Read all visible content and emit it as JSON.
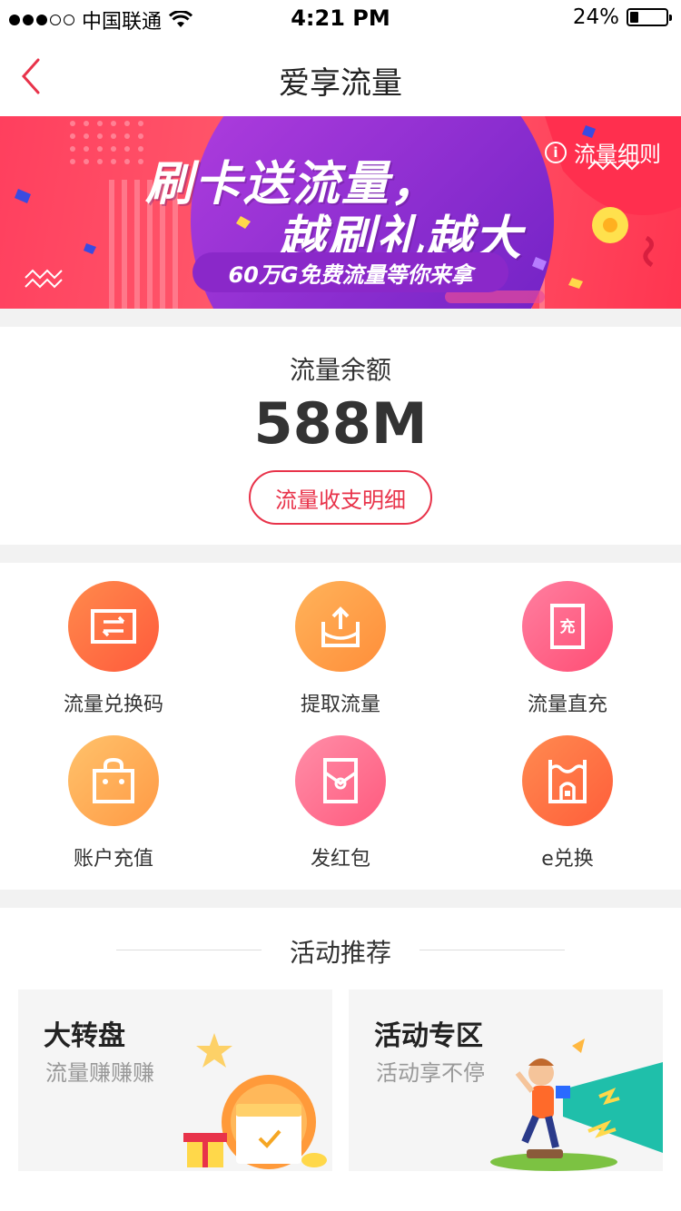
{
  "status_bar": {
    "carrier": "中国联通",
    "time": "4:21 PM",
    "battery": "24%",
    "battery_level": 0.24
  },
  "nav": {
    "title": "爱享流量"
  },
  "banner": {
    "rule_label": "流量细则",
    "headline_line1": "刷卡送流量，",
    "headline_line2": "越刷礼越大",
    "tagline": "60万G免费流量等你来拿"
  },
  "balance": {
    "label": "流量余额",
    "value": "588M",
    "detail_button": "流量收支明细"
  },
  "services": [
    {
      "label": "流量兑换码",
      "icon": "exchange-code-icon",
      "color_from": "#ff8a4c",
      "color_to": "#ff5a3c"
    },
    {
      "label": "提取流量",
      "icon": "extract-icon",
      "color_from": "#ffb35a",
      "color_to": "#ff8e3a"
    },
    {
      "label": "流量直充",
      "icon": "direct-recharge-icon",
      "color_from": "#ff7fa0",
      "color_to": "#ff4d74"
    },
    {
      "label": "账户充值",
      "icon": "shopping-bag-icon",
      "color_from": "#ffc26b",
      "color_to": "#ff9a45"
    },
    {
      "label": "发红包",
      "icon": "red-envelope-icon",
      "color_from": "#ff8ea8",
      "color_to": "#ff5a7e"
    },
    {
      "label": "e兑换",
      "icon": "e-exchange-icon",
      "color_from": "#ff8a50",
      "color_to": "#ff5e3a"
    }
  ],
  "activities": {
    "heading": "活动推荐",
    "cards": [
      {
        "title": "大转盘",
        "subtitle": "流量赚赚赚"
      },
      {
        "title": "活动专区",
        "subtitle": "活动享不停"
      }
    ]
  },
  "icon_text": {
    "recharge_glyph": "充"
  }
}
